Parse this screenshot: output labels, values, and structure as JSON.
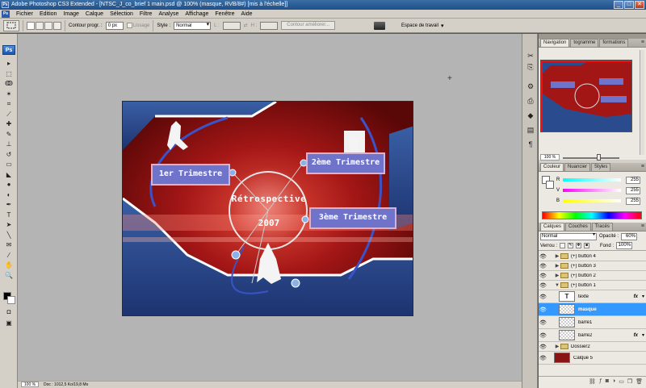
{
  "window": {
    "title": "Adobe Photoshop CS3 Extended - [NTSC_J_co_brief 1 main.psd @ 100% (masque, RVB/8#) [mis à l'échelle]]",
    "app_badge": "Ps",
    "buttons": [
      "_",
      "□",
      "✕"
    ]
  },
  "menubar": {
    "items": [
      "Fichier",
      "Edition",
      "Image",
      "Calque",
      "Sélection",
      "Filtre",
      "Analyse",
      "Affichage",
      "Fenêtre",
      "Aide"
    ]
  },
  "options": {
    "feather_label": "Contour progr. :",
    "feather_value": "0 px",
    "antialias_label": "Lissage",
    "style_label": "Style :",
    "style_value": "Normal",
    "width_label": "L :",
    "height_label": "H :",
    "refine_label": "Contour améliorer...",
    "workspace_label": "Espace de travail"
  },
  "toolbox": {
    "logo": "Ps",
    "tools": [
      {
        "icon": "move-icon",
        "glyph": "▸"
      },
      {
        "icon": "marquee-icon",
        "glyph": "⬚"
      },
      {
        "icon": "lasso-icon",
        "glyph": "ↂ"
      },
      {
        "icon": "magic-wand-icon",
        "glyph": "✶"
      },
      {
        "icon": "crop-icon",
        "glyph": "⌗"
      },
      {
        "icon": "slice-icon",
        "glyph": "⟋"
      },
      {
        "icon": "healing-icon",
        "glyph": "✚"
      },
      {
        "icon": "brush-icon",
        "glyph": "✎"
      },
      {
        "icon": "stamp-icon",
        "glyph": "⊥"
      },
      {
        "icon": "history-brush-icon",
        "glyph": "↺"
      },
      {
        "icon": "eraser-icon",
        "glyph": "▭"
      },
      {
        "icon": "bucket-icon",
        "glyph": "◣"
      },
      {
        "icon": "blur-icon",
        "glyph": "●"
      },
      {
        "icon": "dodge-icon",
        "glyph": "◐"
      },
      {
        "icon": "pen-icon",
        "glyph": "✒"
      },
      {
        "icon": "type-icon",
        "glyph": "T"
      },
      {
        "icon": "path-select-icon",
        "glyph": "➤"
      },
      {
        "icon": "shape-icon",
        "glyph": "╲"
      },
      {
        "icon": "notes-icon",
        "glyph": "✉"
      },
      {
        "icon": "eyedropper-icon",
        "glyph": "⁄"
      },
      {
        "icon": "hand-icon",
        "glyph": "✋"
      },
      {
        "icon": "zoom-icon",
        "glyph": "🔍"
      }
    ]
  },
  "canvas": {
    "btn1": "1er Trimestre",
    "btn2": "2ème Trimestre",
    "btn3": "3ème Trimestre",
    "center_line1": "Rétrospective",
    "center_line2": "2007"
  },
  "status": {
    "zoom": "100 %",
    "doc": "Doc : 1012,5 Ko/19,8 Mo"
  },
  "dock": [
    "✂",
    "⎘",
    "⚙",
    "⎙",
    "◆",
    "▤",
    "¶"
  ],
  "navigator": {
    "tabs": [
      "Navigation",
      "togramme",
      "formations"
    ],
    "zoom": "100 %"
  },
  "color": {
    "tabs": [
      "Couleur",
      "Nuancier",
      "Styles"
    ],
    "rows": [
      {
        "ch": "R",
        "val": "255",
        "grad": "#00ffff"
      },
      {
        "ch": "V",
        "val": "255",
        "grad": "#ff00ff"
      },
      {
        "ch": "B",
        "val": "255",
        "grad": "#ffff00"
      }
    ]
  },
  "layers": {
    "tabs": [
      "Calques",
      "Couches",
      "Tracés"
    ],
    "blend": "Normal",
    "opacity_label": "Opacité :",
    "opacity": "60%",
    "lock_label": "Verrou :",
    "fill_label": "Fond :",
    "fill": "100%",
    "items": [
      {
        "name": "(+) button 4",
        "kind": "folder",
        "indent": 0,
        "collapsed": true
      },
      {
        "name": "(+) button 3",
        "kind": "folder",
        "indent": 0,
        "collapsed": true
      },
      {
        "name": "(+) button 2",
        "kind": "folder",
        "indent": 0,
        "collapsed": true
      },
      {
        "name": "(+) button 1",
        "kind": "folder",
        "indent": 0,
        "collapsed": false
      },
      {
        "name": "texte",
        "kind": "text",
        "indent": 1,
        "fx": true
      },
      {
        "name": "masque",
        "kind": "pixel",
        "indent": 1,
        "selected": true
      },
      {
        "name": "barre1",
        "kind": "pixel",
        "indent": 1
      },
      {
        "name": "barre2",
        "kind": "pixel",
        "indent": 1,
        "fx": true
      },
      {
        "name": "Dossier2",
        "kind": "folder",
        "indent": 0,
        "collapsed": true
      },
      {
        "name": "Calque 5",
        "kind": "pixel",
        "indent": 0
      }
    ],
    "fx_label": "fx"
  },
  "colors": {
    "selection": "#3399ff",
    "bg_red": "#8a0f0f",
    "bg_blue": "#1d3f7f",
    "button_fill": "#6f73c9"
  }
}
